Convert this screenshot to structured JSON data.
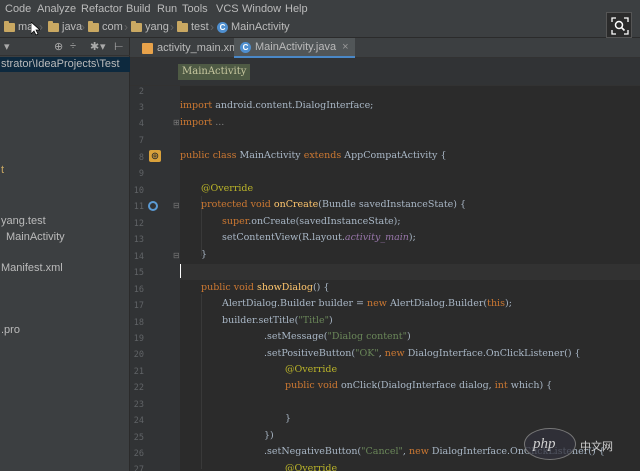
{
  "menu": [
    "Code",
    "Analyze",
    "Refactor",
    "Build",
    "Run",
    "Tools",
    "VCS",
    "Window",
    "Help"
  ],
  "nav": {
    "crumbs": [
      "ma",
      "java",
      "com",
      "yang",
      "test",
      "MainActivity"
    ]
  },
  "sidebar": {
    "rows": [
      {
        "label": "strator\\IdeaProjects\\Test"
      },
      {
        "label": "t"
      },
      {
        "label": "yang.test"
      },
      {
        "label": "MainActivity"
      },
      {
        "label": "Manifest.xml"
      },
      {
        "label": ".pro"
      }
    ]
  },
  "tabs": [
    {
      "label": "activity_main.xml",
      "close": "×"
    },
    {
      "label": "MainActivity.java",
      "close": "×"
    }
  ],
  "breadcrumb": "MainActivity",
  "line_numbers": [
    "2",
    "3",
    "4",
    "7",
    "8",
    "9",
    "10",
    "11",
    "12",
    "13",
    "14",
    "15",
    "16",
    "17",
    "18",
    "19",
    "20",
    "21",
    "22",
    "23",
    "24",
    "25",
    "26",
    "27"
  ],
  "code": {
    "l3_k": "import ",
    "l3_t": "android.content.DialogInterface;",
    "l4_k": "import ",
    "l4_t": "...",
    "l8_k": "public class ",
    "l8_t": "MainActivity ",
    "l8_k2": "extends ",
    "l8_t2": "AppCompatActivity {",
    "l10_a": "@Override",
    "l11_k": "protected void ",
    "l11_m": "onCreate",
    "l11_t": "(Bundle savedInstanceState) {",
    "l12_k": "super",
    "l12_t": ".onCreate(savedInstanceState);",
    "l13_t": "setContentView(R.layout.",
    "l13_f": "activity_main",
    "l13_t2": ");",
    "l14_t": "}",
    "l16_k": "public void ",
    "l16_m": "showDialog",
    "l16_t": "() {",
    "l17_t": "AlertDialog.Builder builder = ",
    "l17_k": "new ",
    "l17_t2": "AlertDialog.Builder(",
    "l17_k2": "this",
    "l17_t3": ");",
    "l18_t": "builder.setTitle(",
    "l18_s": "\"Title\"",
    "l18_t2": ")",
    "l19_t": ".setMessage(",
    "l19_s": "\"Dialog content\"",
    "l19_t2": ")",
    "l20_t": ".setPositiveButton(",
    "l20_s": "\"OK\"",
    "l20_t2": ", ",
    "l20_k": "new ",
    "l20_t3": "DialogInterface.OnClickListener() {",
    "l21_a": "@Override",
    "l22_k": "public void ",
    "l22_t": "onClick(DialogInterface dialog, ",
    "l22_k2": "int ",
    "l22_t2": "which) {",
    "l24_t": "}",
    "l25_t": "})",
    "l26_t": ".setNegativeButton(",
    "l26_s": "\"Cancel\"",
    "l26_t2": ", ",
    "l26_k": "new ",
    "l26_t3": "DialogInterface.OnClickListener() {",
    "l27_a": "@Override"
  },
  "watermark": {
    "logo": "php",
    "cn": "中文网"
  },
  "colors": {
    "keyword": "#cc7832",
    "annotation": "#bbb529",
    "string": "#6a8759",
    "method": "#ffc66d",
    "field": "#9876aa",
    "text": "#a9b7c6"
  }
}
